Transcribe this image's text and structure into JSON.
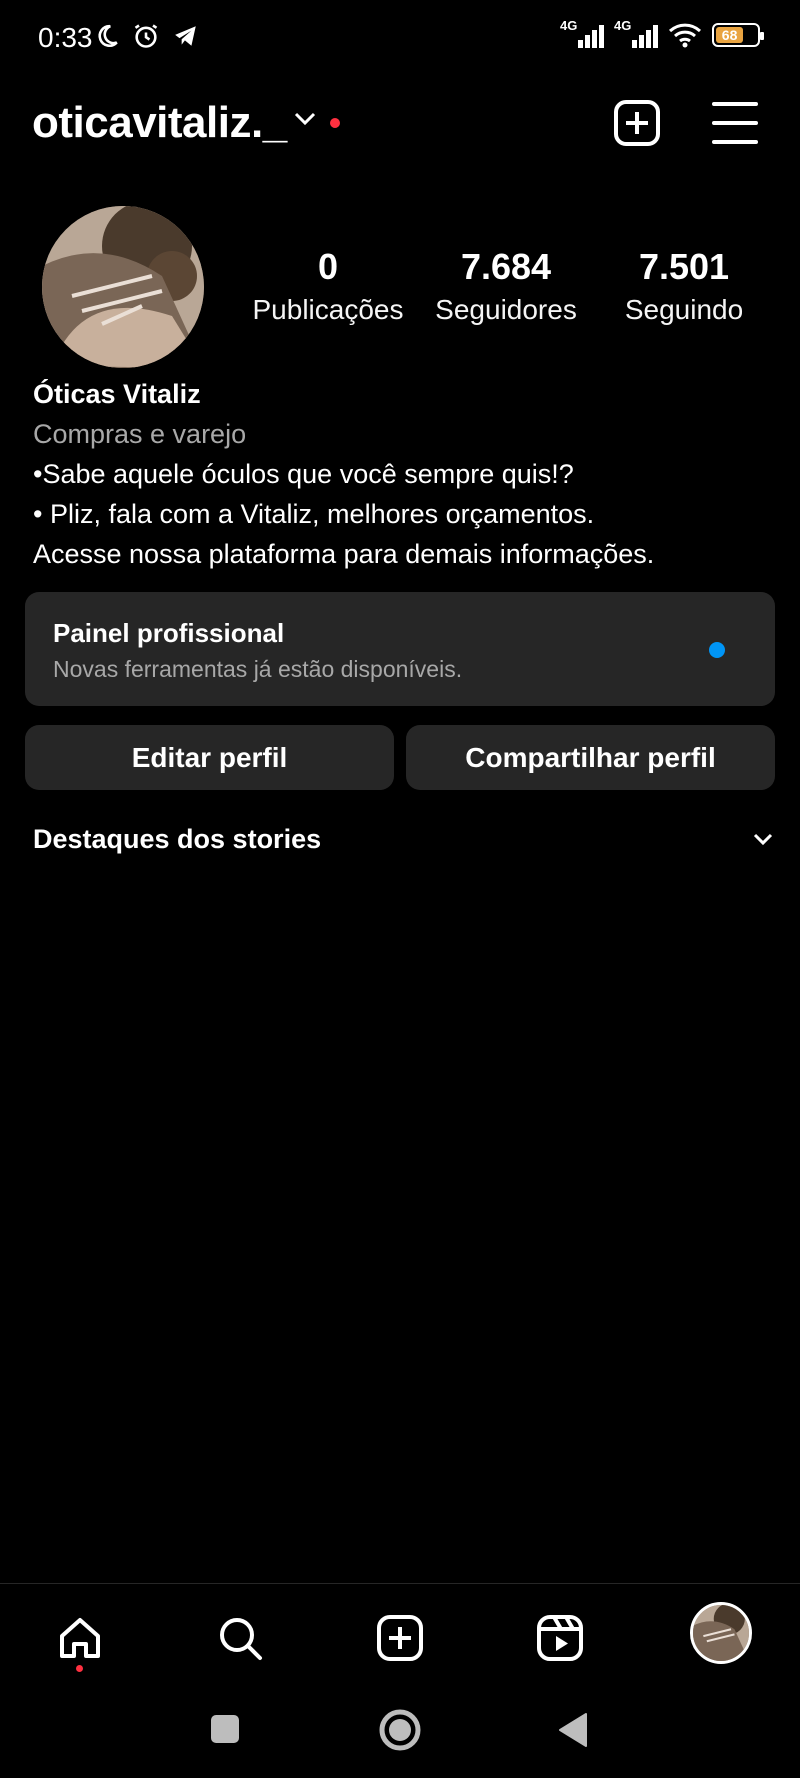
{
  "status_bar": {
    "time": "0:33",
    "signal1_label": "4G",
    "signal2_label": "4G",
    "battery_level": "68",
    "battery_color": "#e9a441"
  },
  "header": {
    "username": "oticavitaliz._",
    "chevron_icon": "chevron-down-icon",
    "add_icon": "plus-square-icon",
    "menu_icon": "hamburger-menu-icon"
  },
  "profile": {
    "stats": [
      {
        "value": "0",
        "label": "Publicações"
      },
      {
        "value": "7.684",
        "label": "Seguidores"
      },
      {
        "value": "7.501",
        "label": "Seguindo"
      }
    ],
    "name": "Óticas Vitaliz",
    "category": "Compras e varejo",
    "bio_lines": [
      "•Sabe aquele óculos que você sempre quis!?",
      "• Pliz, fala com a Vitaliz, melhores orçamentos.",
      "Acesse nossa plataforma para demais informações."
    ]
  },
  "pro_panel": {
    "title": "Painel profissional",
    "subtitle": "Novas ferramentas já estão disponíveis.",
    "dot_color": "#0095f6"
  },
  "buttons": {
    "edit": "Editar perfil",
    "share": "Compartilhar perfil"
  },
  "highlights": {
    "title": "Destaques dos stories"
  },
  "bottom_nav": {
    "items": [
      "home-icon",
      "search-icon",
      "create-icon",
      "reels-icon",
      "profile-avatar"
    ]
  },
  "colors": {
    "background": "#000000",
    "surface": "#262626",
    "accent_blue": "#0095f6",
    "notification_red": "#ff3040"
  }
}
